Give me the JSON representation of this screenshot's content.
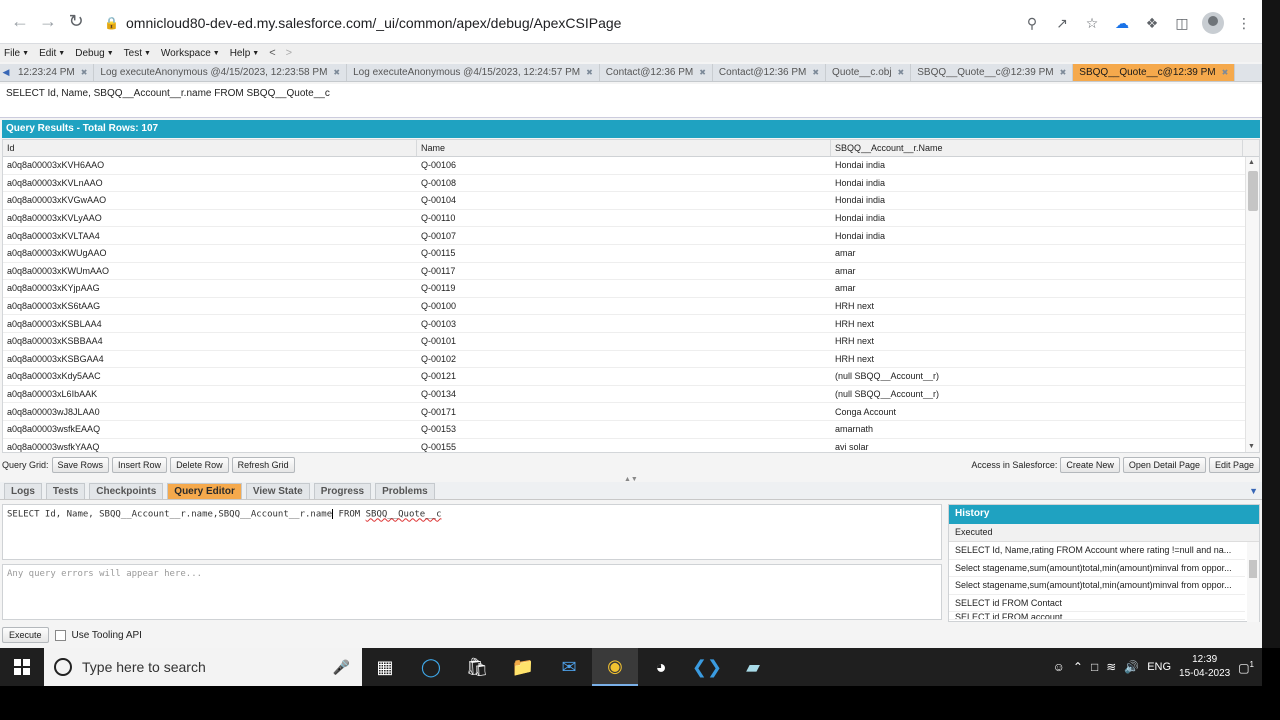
{
  "browser": {
    "url": "omnicloud80-dev-ed.my.salesforce.com/_ui/common/apex/debug/ApexCSIPage"
  },
  "menu": {
    "items": [
      "File",
      "Edit",
      "Debug",
      "Test",
      "Workspace",
      "Help"
    ],
    "back_glyph": "<",
    "forward_glyph": ">"
  },
  "tabs": [
    {
      "label": "12:23:24 PM",
      "active": false
    },
    {
      "label": "Log executeAnonymous @4/15/2023, 12:23:58 PM",
      "active": false
    },
    {
      "label": "Log executeAnonymous @4/15/2023, 12:24:57 PM",
      "active": false
    },
    {
      "label": "Contact@12:36 PM",
      "active": false
    },
    {
      "label": "Contact@12:36 PM",
      "active": false
    },
    {
      "label": "Quote__c.obj",
      "active": false
    },
    {
      "label": "SBQQ__Quote__c@12:39 PM",
      "active": false
    },
    {
      "label": "SBQQ__Quote__c@12:39 PM",
      "active": true
    }
  ],
  "query_text": "SELECT Id, Name, SBQQ__Account__r.name FROM SBQQ__Quote__c",
  "results": {
    "title": "Query Results - Total Rows: 107",
    "columns": [
      "Id",
      "Name",
      "SBQQ__Account__r.Name"
    ],
    "rows": [
      [
        "a0q8a00003xKVH6AAO",
        "Q-00106",
        "Hondai india"
      ],
      [
        "a0q8a00003xKVLnAAO",
        "Q-00108",
        "Hondai india"
      ],
      [
        "a0q8a00003xKVGwAAO",
        "Q-00104",
        "Hondai india"
      ],
      [
        "a0q8a00003xKVLyAAO",
        "Q-00110",
        "Hondai india"
      ],
      [
        "a0q8a00003xKVLTAA4",
        "Q-00107",
        "Hondai india"
      ],
      [
        "a0q8a00003xKWUgAAO",
        "Q-00115",
        "amar"
      ],
      [
        "a0q8a00003xKWUmAAO",
        "Q-00117",
        "amar"
      ],
      [
        "a0q8a00003xKYjpAAG",
        "Q-00119",
        "amar"
      ],
      [
        "a0q8a00003xKS6tAAG",
        "Q-00100",
        "HRH next"
      ],
      [
        "a0q8a00003xKSBLAA4",
        "Q-00103",
        "HRH next"
      ],
      [
        "a0q8a00003xKSBBAA4",
        "Q-00101",
        "HRH next"
      ],
      [
        "a0q8a00003xKSBGAA4",
        "Q-00102",
        "HRH next"
      ],
      [
        "a0q8a00003xKdy5AAC",
        "Q-00121",
        "(null SBQQ__Account__r)"
      ],
      [
        "a0q8a00003xL6IbAAK",
        "Q-00134",
        "(null SBQQ__Account__r)"
      ],
      [
        "a0q8a00003wJ8JLAA0",
        "Q-00171",
        "Conga Account"
      ],
      [
        "a0q8a00003wsfkEAAQ",
        "Q-00153",
        "amarnath"
      ],
      [
        "a0q8a00003wsfkYAAQ",
        "Q-00155",
        "avi solar"
      ]
    ]
  },
  "grid_toolbar": {
    "label": "Query Grid:",
    "left_buttons": [
      "Save Rows",
      "Insert Row",
      "Delete Row",
      "Refresh Grid"
    ],
    "access_label": "Access in Salesforce:",
    "right_buttons": [
      "Create New",
      "Open Detail Page",
      "Edit Page"
    ]
  },
  "bottom_tabs": [
    {
      "label": "Logs",
      "active": false
    },
    {
      "label": "Tests",
      "active": false
    },
    {
      "label": "Checkpoints",
      "active": false
    },
    {
      "label": "Query Editor",
      "active": true
    },
    {
      "label": "View State",
      "active": false
    },
    {
      "label": "Progress",
      "active": false
    },
    {
      "label": "Problems",
      "active": false
    }
  ],
  "editor": {
    "before_cursor": "SELECT Id, Name, SBQQ__Account__r.name,SBQQ__Account__r.name",
    "after_cursor": " FROM ",
    "object": "SBQQ__Quote__c",
    "error_placeholder": "Any query errors will appear here..."
  },
  "history": {
    "title": "History",
    "sub": "Executed",
    "items": [
      "SELECT Id, Name,rating FROM Account where rating !=null and na...",
      "Select stagename,sum(amount)total,min(amount)minval from oppor...",
      "Select stagename,sum(amount)total,min(amount)minval from oppor...",
      "SELECT id FROM Contact",
      "SELECT id FROM account"
    ]
  },
  "execute": {
    "button": "Execute",
    "tooling_label": "Use Tooling API"
  },
  "taskbar": {
    "search_placeholder": "Type here to search",
    "language": "ENG",
    "time": "12:39",
    "date": "15-04-2023",
    "notification_count": "1"
  }
}
